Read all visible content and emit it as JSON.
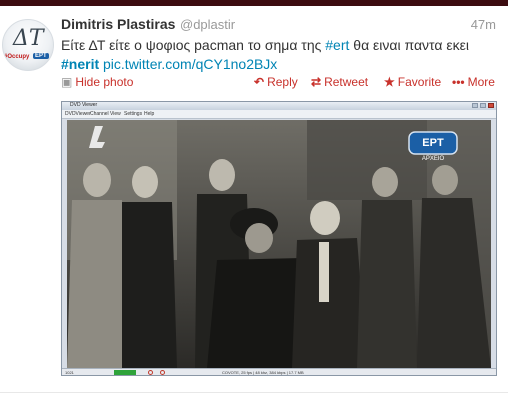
{
  "tweet": {
    "author_name": "Dimitris Plastiras",
    "author_handle": "@dplastir",
    "timestamp": "47m",
    "text_parts": [
      {
        "text": "Είτε ΔΤ είτε ο ψοφιος pacman το σημα της ",
        "type": "plain"
      },
      {
        "text": "#ert",
        "type": "hashtag"
      },
      {
        "text": " θα ειναι παντα εκει ",
        "type": "plain"
      },
      {
        "text": "#nerit",
        "type": "hashtag_bold"
      },
      {
        "text": " ",
        "type": "plain"
      },
      {
        "text": "pic.twitter.com/qCY1no2BJx",
        "type": "link"
      }
    ]
  },
  "avatar": {
    "glyph": "ΔΤ",
    "occupy_label": "#Occupy",
    "ept_label": "ΕΡΤ"
  },
  "actions": {
    "hide_photo": "Hide photo",
    "reply": "Reply",
    "retweet": "Retweet",
    "favorite": "Favorite",
    "more": "More"
  },
  "media": {
    "window_title": "DVD Viewer",
    "menu_items": [
      "DVDViewer",
      "Channel",
      "View",
      "Settings",
      "Help"
    ],
    "channel_logo_text": "ΕΡΤ",
    "channel_logo_sub": "ΑΡΧΕΙΟ",
    "corner_logo": "4",
    "status_left": "1021",
    "status_right": "COVOTE, 25 fps | 48 khz, 384 kbps | 17.7 MB"
  },
  "colors": {
    "link": "#0084b4",
    "action_red": "#c8312b",
    "top_bar": "#3c0c10",
    "ept_blue": "#1b5fa6"
  }
}
